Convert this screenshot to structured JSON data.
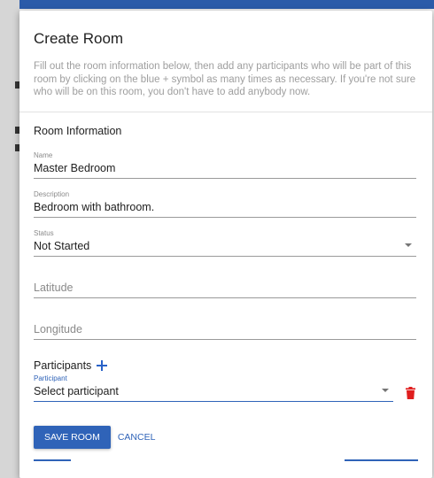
{
  "dialog": {
    "title": "Create Room",
    "intro": "Fill out the room information below, then add any participants who will be part of this room by clicking on the blue + symbol as many times as necessary. If you're not sure who will be on this room, you don't have to add anybody now."
  },
  "form": {
    "section_title": "Room Information",
    "name": {
      "label": "Name",
      "value": "Master Bedroom"
    },
    "description": {
      "label": "Description",
      "value": "Bedroom with bathroom."
    },
    "status": {
      "label": "Status",
      "value": "Not Started"
    },
    "latitude": {
      "placeholder": "Latitude"
    },
    "longitude": {
      "placeholder": "Longitude"
    }
  },
  "participants": {
    "label": "Participants",
    "field_label": "Participant",
    "placeholder": "Select participant"
  },
  "actions": {
    "save_label": "SAVE ROOM",
    "cancel_label": "CANCEL"
  },
  "colors": {
    "accent": "#2f63b8",
    "delete": "#e01e1e"
  },
  "icons": {
    "add": "plus-icon",
    "delete": "trash-icon",
    "dropdown": "chevron-down-icon"
  }
}
